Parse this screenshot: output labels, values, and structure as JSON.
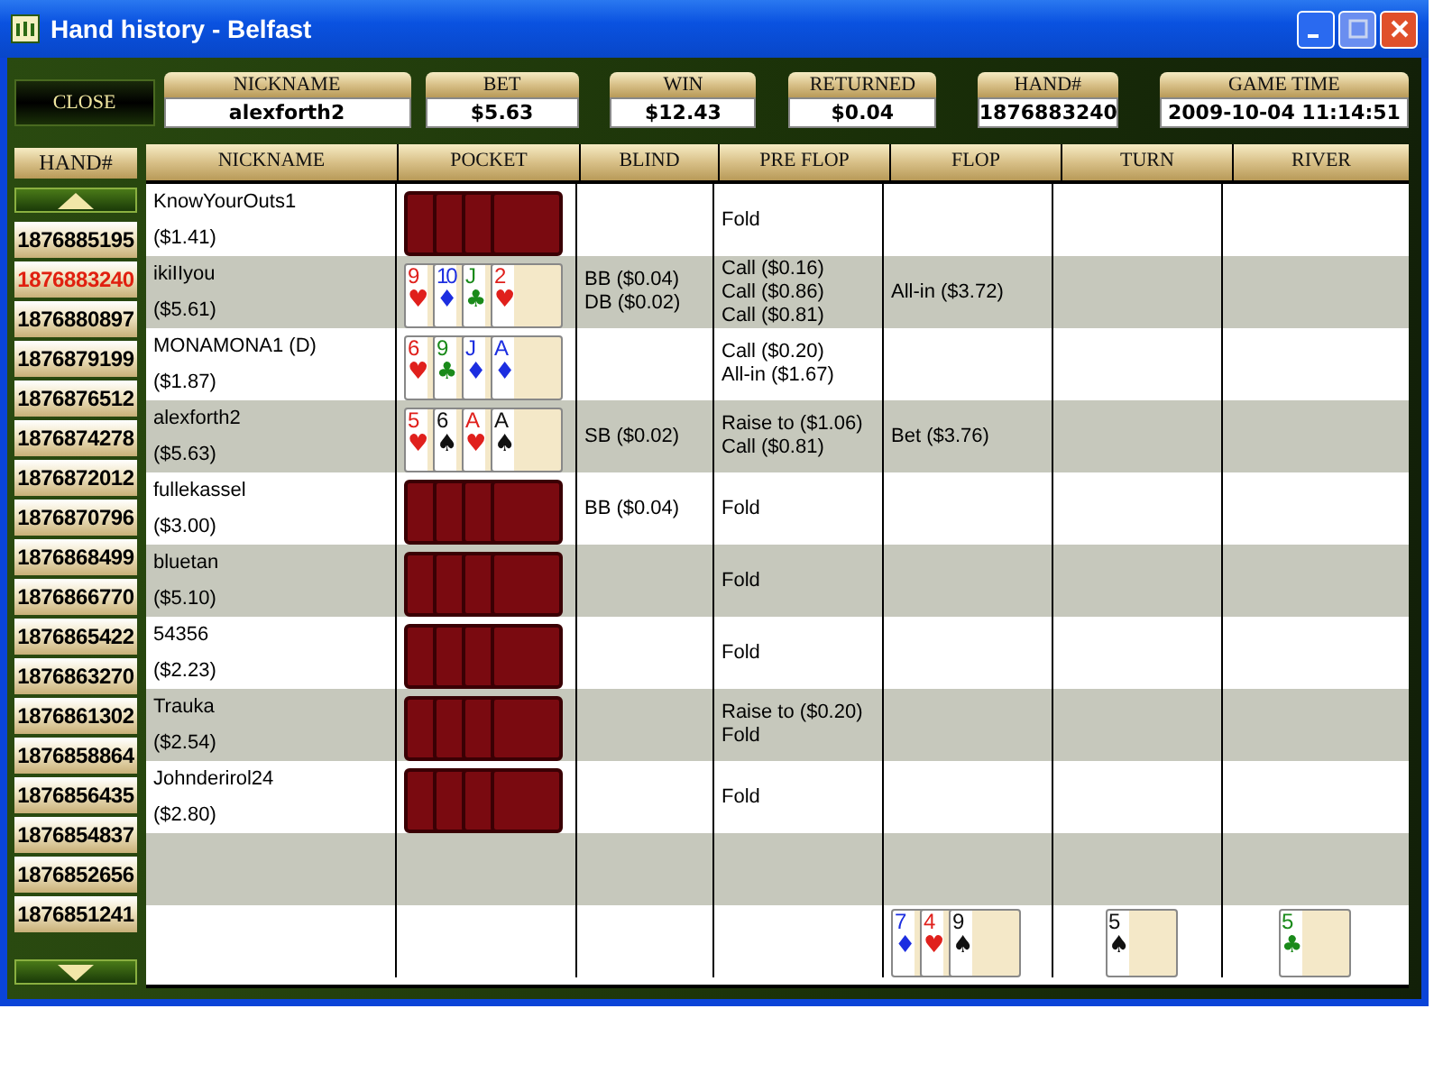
{
  "window": {
    "title": "Hand history - Belfast"
  },
  "close_button": {
    "label": "CLOSE"
  },
  "summary": [
    {
      "label": "NICKNAME",
      "value": "alexforth2"
    },
    {
      "label": "BET",
      "value": "$5.63"
    },
    {
      "label": "WIN",
      "value": "$12.43"
    },
    {
      "label": "RETURNED",
      "value": "$0.04"
    },
    {
      "label": "HAND#",
      "value": "1876883240"
    },
    {
      "label": "GAME TIME",
      "value": "2009-10-04 11:14:51"
    }
  ],
  "hand_list": {
    "header": "HAND#",
    "hands": [
      {
        "number": "1876885195",
        "selected": false
      },
      {
        "number": "1876883240",
        "selected": true
      },
      {
        "number": "1876880897",
        "selected": false
      },
      {
        "number": "1876879199",
        "selected": false
      },
      {
        "number": "1876876512",
        "selected": false
      },
      {
        "number": "1876874278",
        "selected": false
      },
      {
        "number": "1876872012",
        "selected": false
      },
      {
        "number": "1876870796",
        "selected": false
      },
      {
        "number": "1876868499",
        "selected": false
      },
      {
        "number": "1876866770",
        "selected": false
      },
      {
        "number": "1876865422",
        "selected": false
      },
      {
        "number": "1876863270",
        "selected": false
      },
      {
        "number": "1876861302",
        "selected": false
      },
      {
        "number": "1876858864",
        "selected": false
      },
      {
        "number": "1876856435",
        "selected": false
      },
      {
        "number": "1876854837",
        "selected": false
      },
      {
        "number": "1876852656",
        "selected": false
      },
      {
        "number": "1876851241",
        "selected": false
      }
    ]
  },
  "table": {
    "columns": [
      "NICKNAME",
      "POCKET",
      "BLIND",
      "PRE FLOP",
      "FLOP",
      "TURN",
      "RIVER"
    ],
    "rows": [
      {
        "nickname": "KnowYourOuts1",
        "stack": "($1.41)",
        "pocket": [
          {
            "kind": "back"
          },
          {
            "kind": "back"
          },
          {
            "kind": "back"
          },
          {
            "kind": "back"
          }
        ],
        "blind": [],
        "pre_flop": [
          "Fold"
        ],
        "flop": []
      },
      {
        "nickname": "ikiIIyou",
        "stack": "($5.61)",
        "pocket": [
          {
            "kind": "face",
            "rank": "9",
            "suit": "♥",
            "color": "#e0201c"
          },
          {
            "kind": "face",
            "rank": "10",
            "suit": "♦",
            "color": "#1c2ee0"
          },
          {
            "kind": "face",
            "rank": "J",
            "suit": "♣",
            "color": "#1a8a1a"
          },
          {
            "kind": "face",
            "rank": "2",
            "suit": "♥",
            "color": "#e0201c"
          }
        ],
        "blind": [
          "BB ($0.04)",
          "DB ($0.02)"
        ],
        "pre_flop": [
          "Call ($0.16)",
          "Call ($0.86)",
          "Call ($0.81)"
        ],
        "flop": [
          "All-in ($3.72)"
        ]
      },
      {
        "nickname": "MONAMONA1 (D)",
        "stack": "($1.87)",
        "pocket": [
          {
            "kind": "face",
            "rank": "6",
            "suit": "♥",
            "color": "#e0201c"
          },
          {
            "kind": "face",
            "rank": "9",
            "suit": "♣",
            "color": "#1a8a1a"
          },
          {
            "kind": "face",
            "rank": "J",
            "suit": "♦",
            "color": "#1c2ee0"
          },
          {
            "kind": "face",
            "rank": "A",
            "suit": "♦",
            "color": "#1c2ee0"
          }
        ],
        "blind": [],
        "pre_flop": [
          "Call ($0.20)",
          "All-in ($1.67)"
        ],
        "flop": []
      },
      {
        "nickname": "alexforth2",
        "stack": "($5.63)",
        "pocket": [
          {
            "kind": "face",
            "rank": "5",
            "suit": "♥",
            "color": "#e0201c"
          },
          {
            "kind": "face",
            "rank": "6",
            "suit": "♠",
            "color": "#111111"
          },
          {
            "kind": "face",
            "rank": "A",
            "suit": "♥",
            "color": "#e0201c"
          },
          {
            "kind": "face",
            "rank": "A",
            "suit": "♠",
            "color": "#111111"
          }
        ],
        "blind": [
          "SB ($0.02)"
        ],
        "pre_flop": [
          "Raise to ($1.06)",
          "Call ($0.81)"
        ],
        "flop": [
          "Bet ($3.76)"
        ]
      },
      {
        "nickname": "fullekassel",
        "stack": "($3.00)",
        "pocket": [
          {
            "kind": "back"
          },
          {
            "kind": "back"
          },
          {
            "kind": "back"
          },
          {
            "kind": "back"
          }
        ],
        "blind": [
          "BB ($0.04)"
        ],
        "pre_flop": [
          "Fold"
        ],
        "flop": []
      },
      {
        "nickname": "bluetan",
        "stack": "($5.10)",
        "pocket": [
          {
            "kind": "back"
          },
          {
            "kind": "back"
          },
          {
            "kind": "back"
          },
          {
            "kind": "back"
          }
        ],
        "blind": [],
        "pre_flop": [
          "Fold"
        ],
        "flop": []
      },
      {
        "nickname": "54356",
        "stack": "($2.23)",
        "pocket": [
          {
            "kind": "back"
          },
          {
            "kind": "back"
          },
          {
            "kind": "back"
          },
          {
            "kind": "back"
          }
        ],
        "blind": [],
        "pre_flop": [
          "Fold"
        ],
        "flop": []
      },
      {
        "nickname": "Trauka",
        "stack": "($2.54)",
        "pocket": [
          {
            "kind": "back"
          },
          {
            "kind": "back"
          },
          {
            "kind": "back"
          },
          {
            "kind": "back"
          }
        ],
        "blind": [],
        "pre_flop": [
          "Raise to ($0.20)",
          "Fold"
        ],
        "flop": []
      },
      {
        "nickname": "Johnderirol24",
        "stack": "($2.80)",
        "pocket": [
          {
            "kind": "back"
          },
          {
            "kind": "back"
          },
          {
            "kind": "back"
          },
          {
            "kind": "back"
          }
        ],
        "blind": [],
        "pre_flop": [
          "Fold"
        ],
        "flop": []
      }
    ],
    "board": {
      "flop": [
        {
          "kind": "face",
          "rank": "7",
          "suit": "♦",
          "color": "#1c2ee0"
        },
        {
          "kind": "face",
          "rank": "4",
          "suit": "♥",
          "color": "#e0201c"
        },
        {
          "kind": "face",
          "rank": "9",
          "suit": "♠",
          "color": "#111111"
        }
      ],
      "turn": [
        {
          "kind": "face",
          "rank": "5",
          "suit": "♠",
          "color": "#111111"
        }
      ],
      "river": [
        {
          "kind": "face",
          "rank": "5",
          "suit": "♣",
          "color": "#1a8a1a"
        }
      ]
    }
  }
}
